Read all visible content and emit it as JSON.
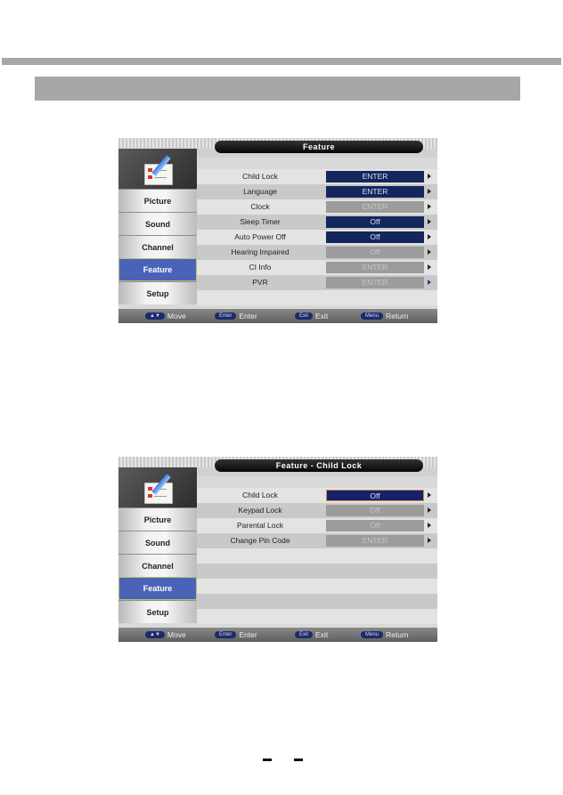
{
  "screens": [
    {
      "title": "Feature",
      "sidebar": [
        {
          "label": "Picture",
          "active": false
        },
        {
          "label": "Sound",
          "active": false
        },
        {
          "label": "Channel",
          "active": false
        },
        {
          "label": "Feature",
          "active": true
        },
        {
          "label": "Setup",
          "active": false
        }
      ],
      "rows": [
        {
          "label": "Child Lock",
          "value": "ENTER",
          "state": "blue"
        },
        {
          "label": "Language",
          "value": "ENTER",
          "state": "blue"
        },
        {
          "label": "Clock",
          "value": "ENTER",
          "state": "grey"
        },
        {
          "label": "Sleep Timer",
          "value": "Off",
          "state": "blue"
        },
        {
          "label": "Auto Power Off",
          "value": "Off",
          "state": "blue"
        },
        {
          "label": "Hearing Impaired",
          "value": "Off",
          "state": "grey"
        },
        {
          "label": "CI Info",
          "value": "ENTER",
          "state": "grey"
        },
        {
          "label": "PVR",
          "value": "ENTER",
          "state": "grey"
        }
      ],
      "footer": [
        {
          "key": "▲▼",
          "label": "Move"
        },
        {
          "key": "Enter",
          "label": "Enter"
        },
        {
          "key": "Exit",
          "label": "Exit"
        },
        {
          "key": "Menu",
          "label": "Return"
        }
      ]
    },
    {
      "title": "Feature - Child Lock",
      "sidebar": [
        {
          "label": "Picture",
          "active": false
        },
        {
          "label": "Sound",
          "active": false
        },
        {
          "label": "Channel",
          "active": false
        },
        {
          "label": "Feature",
          "active": true
        },
        {
          "label": "Setup",
          "active": false
        }
      ],
      "rows": [
        {
          "label": "Child Lock",
          "value": "Off",
          "state": "focused"
        },
        {
          "label": "Keypad Lock",
          "value": "Off",
          "state": "grey"
        },
        {
          "label": "Parental Lock",
          "value": "Off",
          "state": "grey"
        },
        {
          "label": "Change Pin Code",
          "value": "ENTER",
          "state": "grey"
        }
      ],
      "empty_rows": 5,
      "footer": [
        {
          "key": "▲▼",
          "label": "Move"
        },
        {
          "key": "Enter",
          "label": "Enter"
        },
        {
          "key": "Exit",
          "label": "Exit"
        },
        {
          "key": "Menu",
          "label": "Return"
        }
      ]
    }
  ],
  "icons": {
    "menu_category_icon": "notepad-checklist-pencil-icon",
    "row_arrow": "triangle-right-icon"
  }
}
